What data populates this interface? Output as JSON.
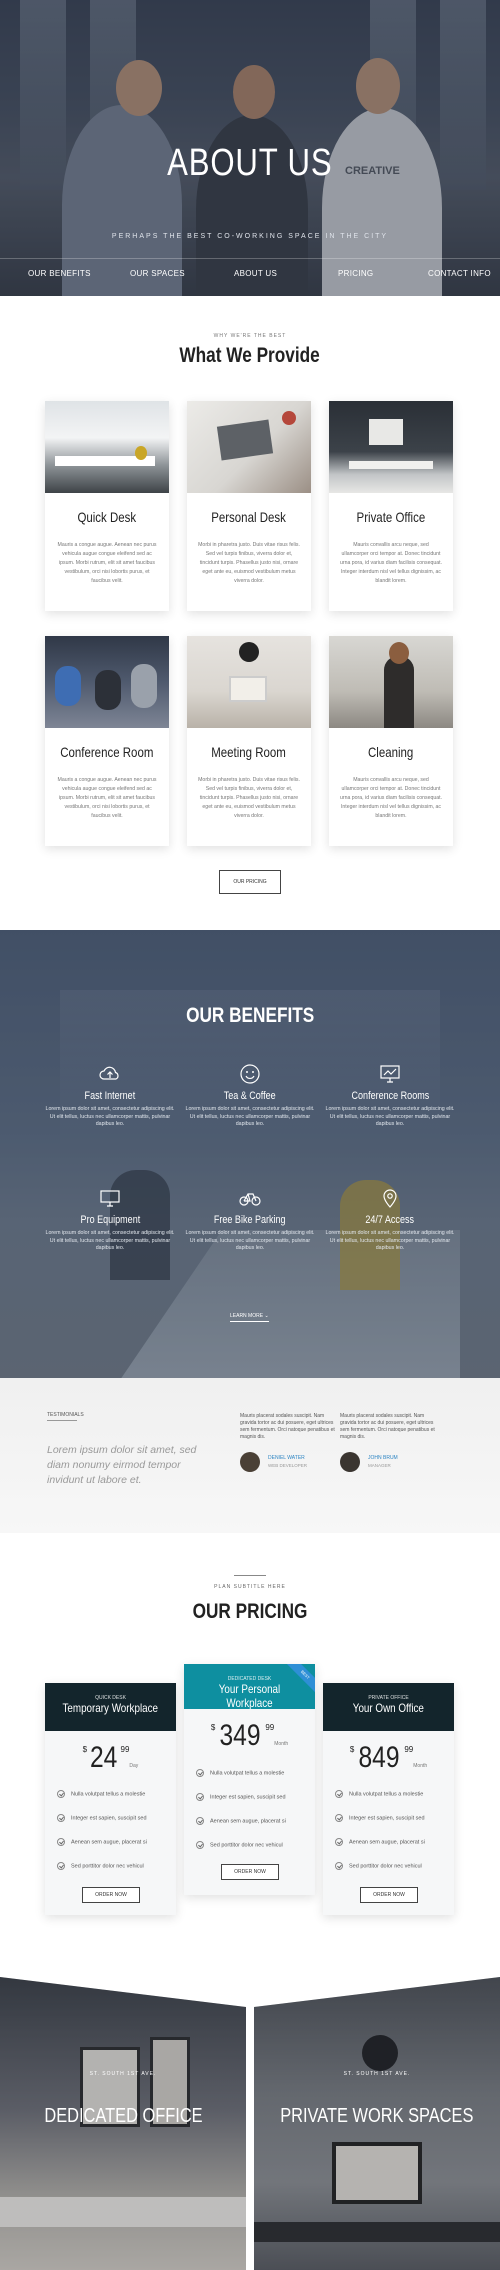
{
  "hero": {
    "title": "ABOUT US",
    "subtitle": "PERHAPS THE BEST CO-WORKING SPACE IN THE CITY",
    "shirt_text": "CREATIVE",
    "nav": [
      "OUR BENEFITS",
      "OUR SPACES",
      "ABOUT US",
      "PRICING",
      "CONTACT INFO"
    ]
  },
  "provide": {
    "kicker": "WHY WE'RE THE BEST",
    "title": "What We Provide",
    "cards": [
      {
        "title": "Quick Desk",
        "text": "Mauris a congue augue. Aenean nec purus vehicula augue congue eleifend sed ac ipsum. Morbi rutrum, elit sit amet faucibus vestibulum, orci nisi lobortis purus, et faucibus velit."
      },
      {
        "title": "Personal Desk",
        "text": "Morbi in pharetra justo. Duis vitae risus felis. Sed vel turpis finibus, viverra dolor et, tincidunt turpis. Phasellus justo nisi, ornare eget ante eu, euismod vestibulum metus viverra dolor."
      },
      {
        "title": "Private Office",
        "text": "Mauris convallis arcu neque, sed ullamcorper orci tempor at. Donec tincidunt urna pora, id varius diam facilisis consequat. Integer interdum nisl vel tellus dignissim, ac blandit lorem."
      },
      {
        "title": "Conference Room",
        "text": "Mauris a congue augue. Aenean nec purus vehicula augue congue eleifend sed ac ipsum. Morbi rutrum, elit sit amet faucibus vestibulum, orci nisi lobortis purus, et faucibus velit."
      },
      {
        "title": "Meeting Room",
        "text": "Morbi in pharetra justo. Duis vitae risus felis. Sed vel turpis finibus, viverra dolor et, tincidunt turpis. Phasellus justo nisi, ornare eget ante eu, euismod vestibulum metus viverra dolor."
      },
      {
        "title": "Cleaning",
        "text": "Mauris convallis arcu neque, sed ullamcorper orci tempor at. Donec tincidunt urna pora, id varius diam facilisis consequat. Integer interdum nisl vel tellus dignissim, ac blandit lorem."
      }
    ],
    "button": "OUR PRICING"
  },
  "benefits": {
    "title": "OUR BENEFITS",
    "items": [
      {
        "icon": "cloud-upload-icon",
        "title": "Fast Internet",
        "text": "Lorem ipsum dolor sit amet, consectetur adipiscing elit. Ut elit tellus, luctus nec ullamcorper mattis, pulvinar dapibus leo."
      },
      {
        "icon": "smiley-icon",
        "title": "Tea & Coffee",
        "text": "Lorem ipsum dolor sit amet, consectetur adipiscing elit. Ut elit tellus, luctus nec ullamcorper mattis, pulvinar dapibus leo."
      },
      {
        "icon": "presentation-icon",
        "title": "Conference Rooms",
        "text": "Lorem ipsum dolor sit amet, consectetur adipiscing elit. Ut elit tellus, luctus nec ullamcorper mattis, pulvinar dapibus leo."
      },
      {
        "icon": "monitor-icon",
        "title": "Pro Equipment",
        "text": "Lorem ipsum dolor sit amet, consectetur adipiscing elit. Ut elit tellus, luctus nec ullamcorper mattis, pulvinar dapibus leo."
      },
      {
        "icon": "bicycle-icon",
        "title": "Free Bike Parking",
        "text": "Lorem ipsum dolor sit amet, consectetur adipiscing elit. Ut elit tellus, luctus nec ullamcorper mattis, pulvinar dapibus leo."
      },
      {
        "icon": "map-pin-icon",
        "title": "24/7 Access",
        "text": "Lorem ipsum dolor sit amet, consectetur adipiscing elit. Ut elit tellus, luctus nec ullamcorper mattis, pulvinar dapibus leo."
      }
    ],
    "learn_more": "LEARN MORE"
  },
  "testimonials": {
    "label": "TESTIMONIALS",
    "quote": "Lorem ipsum dolor sit amet, sed diam nonumy eirmod tempor invidunt ut labore et.",
    "items": [
      {
        "text": "Mauris placerat sodales suscipit. Nam gravida tortor ac dui posuere, eget ultrices sem fermentum. Orci natoque penatibus et magnis dis.",
        "name": "DENIEL WATER",
        "role": "WEB DEVELOPER"
      },
      {
        "text": "Mauris placerat sodales suscipit. Nam gravida tortor ac dui posuere, eget ultrices sem fermentum. Orci natoque penatibus et magnis dis.",
        "name": "JOHN BRUM",
        "role": "MANAGER"
      }
    ]
  },
  "pricing": {
    "kicker": "PLAN SUBTITLE HERE",
    "title": "OUR PRICING",
    "plans": [
      {
        "kicker": "QUICK DESK",
        "name": "Temporary Workplace",
        "currency": "$",
        "amount": "24",
        "cents": "99",
        "period": "Day",
        "features": [
          "Nulla volutpat tellus a molestie",
          "Integer est sapien, suscipit sed",
          "Aenean sem augue, placerat si",
          "Sed porttitor dolor nec vehicul"
        ],
        "button": "ORDER NOW"
      },
      {
        "kicker": "DEDICATED DESK",
        "name": "Your Personal Workplace",
        "currency": "$",
        "amount": "349",
        "cents": "99",
        "period": "Month",
        "ribbon": "BEST",
        "features": [
          "Nulla volutpat tellus a molestie",
          "Integer est sapien, suscipit sed",
          "Aenean sem augue, placerat si",
          "Sed porttitor dolor nec vehicul"
        ],
        "button": "ORDER NOW"
      },
      {
        "kicker": "PRIVATE OFFICE",
        "name": "Your Own Office",
        "currency": "$",
        "amount": "849",
        "cents": "99",
        "period": "Month",
        "features": [
          "Nulla volutpat tellus a molestie",
          "Integer est sapien, suscipit sed",
          "Aenean sem augue, placerat si",
          "Sed porttitor dolor nec vehicul"
        ],
        "button": "ORDER NOW"
      }
    ],
    "accent_color": "#0e8fa0",
    "header_color": "#13252c"
  },
  "panels": [
    {
      "kicker": "ST. SOUTH 1ST AVE.",
      "title": "DEDICATED OFFICE"
    },
    {
      "kicker": "ST. SOUTH 1ST AVE.",
      "title": "PRIVATE WORK SPACES"
    }
  ]
}
